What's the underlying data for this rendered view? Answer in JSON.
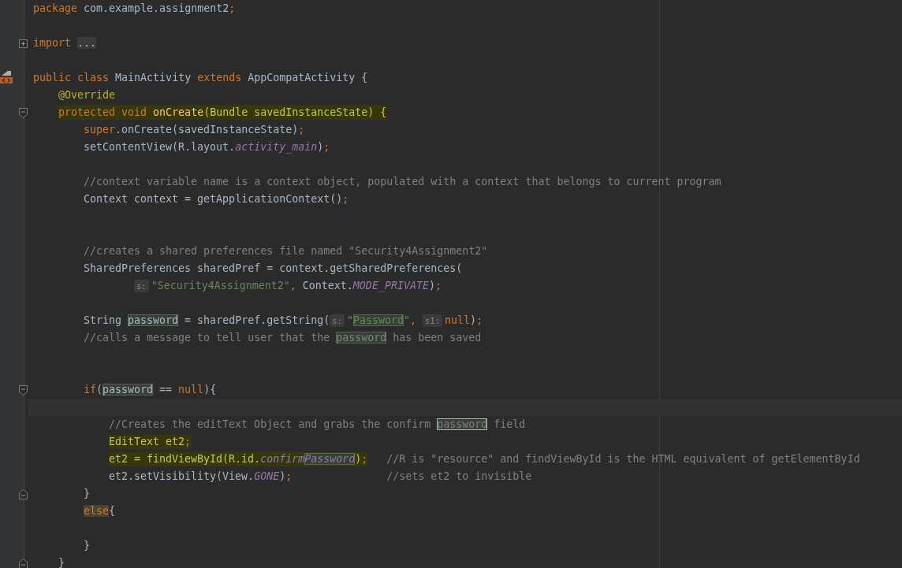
{
  "lines": [
    {
      "kind": "code",
      "segments": [
        {
          "kind": "code",
          "tokens": [
            {
              "text": "package",
              "kind": "keyword"
            },
            {
              "text": " com.example.assignment2",
              "kind": "plain"
            },
            {
              "text": ";",
              "kind": "keyword"
            }
          ]
        }
      ]
    },
    {
      "kind": "blank"
    },
    {
      "kind": "code",
      "marker": {
        "kind": "fold-expand"
      },
      "segments": [
        {
          "kind": "code",
          "tokens": [
            {
              "text": "import ",
              "kind": "keyword"
            },
            {
              "text": "...",
              "kind": "folded"
            }
          ]
        }
      ]
    },
    {
      "kind": "blank"
    },
    {
      "kind": "code",
      "marker": {
        "kind": "implements"
      },
      "segments": [
        {
          "kind": "code",
          "tokens": [
            {
              "text": "public class ",
              "kind": "keyword"
            },
            {
              "text": "MainActivity ",
              "kind": "plain"
            },
            {
              "text": "extends ",
              "kind": "keyword"
            },
            {
              "text": "AppCompatActivity {",
              "kind": "plain"
            }
          ]
        }
      ],
      "children": [
        {
          "kind": "code",
          "segments": [
            {
              "kind": "code",
              "tokens": [
                {
                  "text": "@Override",
                  "kind": "annotation"
                }
              ]
            }
          ]
        },
        {
          "kind": "code",
          "marked": true,
          "marker": {
            "kind": "fold-start"
          },
          "segments": [
            {
              "kind": "code",
              "tokens": [
                {
                  "text": "protected void ",
                  "kind": "keyword"
                },
                {
                  "text": "onCreate",
                  "kind": "method"
                },
                {
                  "text": "(Bundle savedInstanceState) {",
                  "kind": "plain"
                }
              ]
            }
          ],
          "children": [
            {
              "kind": "code",
              "segments": [
                {
                  "kind": "code",
                  "tokens": [
                    {
                      "text": "super",
                      "kind": "keyword"
                    },
                    {
                      "text": ".onCreate(savedInstanceState)",
                      "kind": "plain"
                    },
                    {
                      "text": ";",
                      "kind": "keyword"
                    }
                  ]
                }
              ]
            },
            {
              "kind": "code",
              "segments": [
                {
                  "kind": "code",
                  "tokens": [
                    {
                      "text": "setContentView(R.layout.",
                      "kind": "plain"
                    },
                    {
                      "text": "activity_main",
                      "kind": "constant"
                    },
                    {
                      "text": ")",
                      "kind": "plain"
                    },
                    {
                      "text": ";",
                      "kind": "keyword"
                    }
                  ]
                }
              ]
            },
            {
              "kind": "blank"
            },
            {
              "kind": "code",
              "segments": [
                {
                  "kind": "code",
                  "tokens": [
                    {
                      "text": "//context variable name is a context object, populated with a context that belongs to current program",
                      "kind": "comment"
                    }
                  ]
                }
              ]
            },
            {
              "kind": "code",
              "segments": [
                {
                  "kind": "code",
                  "tokens": [
                    {
                      "text": "Context context = getApplicationContext()",
                      "kind": "plain"
                    },
                    {
                      "text": ";",
                      "kind": "keyword"
                    }
                  ]
                }
              ]
            },
            {
              "kind": "blank"
            },
            {
              "kind": "blank"
            },
            {
              "kind": "code",
              "segments": [
                {
                  "kind": "code",
                  "tokens": [
                    {
                      "text": "//creates a shared preferences file named \"Security4Assignment2\"",
                      "kind": "comment"
                    }
                  ]
                }
              ]
            },
            {
              "kind": "code",
              "segments": [
                {
                  "kind": "code",
                  "tokens": [
                    {
                      "text": "SharedPreferences sharedPref = context.getSharedPreferences(",
                      "kind": "plain"
                    }
                  ]
                }
              ],
              "children": [
                {
                  "kind": "continuation",
                  "segments": [
                    {
                      "kind": "hint",
                      "text": "s:"
                    },
                    {
                      "kind": "code",
                      "tokens": [
                        {
                          "text": "\"Security4Assignment2\"",
                          "kind": "string"
                        },
                        {
                          "text": ",",
                          "kind": "keyword"
                        },
                        {
                          "text": " Context.",
                          "kind": "plain"
                        },
                        {
                          "text": "MODE_PRIVATE",
                          "kind": "constant"
                        },
                        {
                          "text": ")",
                          "kind": "plain"
                        },
                        {
                          "text": ";",
                          "kind": "keyword"
                        }
                      ]
                    }
                  ]
                }
              ]
            },
            {
              "kind": "blank"
            },
            {
              "kind": "code",
              "segments": [
                {
                  "kind": "code",
                  "tokens": [
                    {
                      "text": "String ",
                      "kind": "plain"
                    },
                    {
                      "text": "password",
                      "kind": "usage"
                    },
                    {
                      "text": " = sharedPref.getString(",
                      "kind": "plain"
                    }
                  ]
                },
                {
                  "kind": "hint",
                  "text": "s:"
                },
                {
                  "kind": "code",
                  "tokens": [
                    {
                      "text": "\"",
                      "kind": "string"
                    },
                    {
                      "text": "Password",
                      "kind": "usage-string"
                    },
                    {
                      "text": "\"",
                      "kind": "string"
                    },
                    {
                      "text": ", ",
                      "kind": "keyword"
                    }
                  ]
                },
                {
                  "kind": "hint",
                  "text": "s1:"
                },
                {
                  "kind": "code",
                  "tokens": [
                    {
                      "text": "null",
                      "kind": "keyword"
                    },
                    {
                      "text": ")",
                      "kind": "plain"
                    },
                    {
                      "text": ";",
                      "kind": "keyword"
                    }
                  ]
                }
              ]
            },
            {
              "kind": "code",
              "segments": [
                {
                  "kind": "code",
                  "tokens": [
                    {
                      "text": "//calls a message to tell user that the ",
                      "kind": "comment"
                    },
                    {
                      "text": "password",
                      "kind": "usage-comment"
                    },
                    {
                      "text": " has been saved",
                      "kind": "comment"
                    }
                  ]
                }
              ]
            },
            {
              "kind": "blank"
            },
            {
              "kind": "blank"
            },
            {
              "kind": "code",
              "marker": {
                "kind": "fold-start"
              },
              "segments": [
                {
                  "kind": "code",
                  "tokens": [
                    {
                      "text": "if",
                      "kind": "keyword"
                    },
                    {
                      "text": "(",
                      "kind": "plain"
                    },
                    {
                      "text": "password",
                      "kind": "usage"
                    },
                    {
                      "text": " == ",
                      "kind": "plain"
                    },
                    {
                      "text": "null",
                      "kind": "keyword"
                    },
                    {
                      "text": "){",
                      "kind": "plain"
                    }
                  ]
                }
              ],
              "children": [
                {
                  "kind": "current"
                },
                {
                  "kind": "code",
                  "segments": [
                    {
                      "kind": "code",
                      "tokens": [
                        {
                          "text": "//Creates the editText Object and grabs the confirm ",
                          "kind": "comment"
                        },
                        {
                          "text": "password",
                          "kind": "usage-selected-comment"
                        },
                        {
                          "text": " field",
                          "kind": "comment"
                        }
                      ]
                    }
                  ]
                },
                {
                  "kind": "code",
                  "marked": true,
                  "segments": [
                    {
                      "kind": "code",
                      "tokens": [
                        {
                          "text": "EditText et2",
                          "kind": "plain"
                        },
                        {
                          "text": ";",
                          "kind": "keyword"
                        }
                      ]
                    }
                  ]
                },
                {
                  "kind": "code",
                  "marked": true,
                  "segments": [
                    {
                      "kind": "code",
                      "tokens": [
                        {
                          "text": "et2 = findViewById(R.id.",
                          "kind": "plain"
                        },
                        {
                          "text": "confirm",
                          "kind": "constant"
                        },
                        {
                          "text": "Password",
                          "kind": "usage-constant"
                        },
                        {
                          "text": ")",
                          "kind": "plain"
                        },
                        {
                          "text": ";",
                          "kind": "keyword"
                        }
                      ]
                    }
                  ],
                  "trailing_comment": "//R is \"resource\" and findViewById is the HTML equivalent of getElementById"
                },
                {
                  "kind": "code",
                  "segments": [
                    {
                      "kind": "code",
                      "tokens": [
                        {
                          "text": "et2.setVisibility(View.",
                          "kind": "plain"
                        },
                        {
                          "text": "GONE",
                          "kind": "constant"
                        },
                        {
                          "text": ")",
                          "kind": "plain"
                        },
                        {
                          "text": ";",
                          "kind": "keyword"
                        }
                      ]
                    }
                  ],
                  "trailing_comment": "//sets et2 to invisible"
                }
              ]
            },
            {
              "kind": "code",
              "marker": {
                "kind": "fold-end"
              },
              "segments": [
                {
                  "kind": "code",
                  "tokens": [
                    {
                      "text": "}",
                      "kind": "plain"
                    }
                  ]
                }
              ]
            },
            {
              "kind": "code",
              "segments": [
                {
                  "kind": "code",
                  "tokens": [
                    {
                      "text": "else",
                      "kind": "brace-match"
                    },
                    {
                      "text": "{",
                      "kind": "plain"
                    }
                  ]
                }
              ],
              "children": [
                {
                  "kind": "blank"
                }
              ]
            },
            {
              "kind": "code",
              "segments": [
                {
                  "kind": "code",
                  "tokens": [
                    {
                      "text": "}",
                      "kind": "plain"
                    }
                  ]
                }
              ]
            }
          ]
        },
        {
          "kind": "code",
          "marker": {
            "kind": "fold-end"
          },
          "segments": [
            {
              "kind": "code",
              "tokens": [
                {
                  "text": "}",
                  "kind": "plain"
                }
              ]
            }
          ]
        }
      ]
    }
  ]
}
